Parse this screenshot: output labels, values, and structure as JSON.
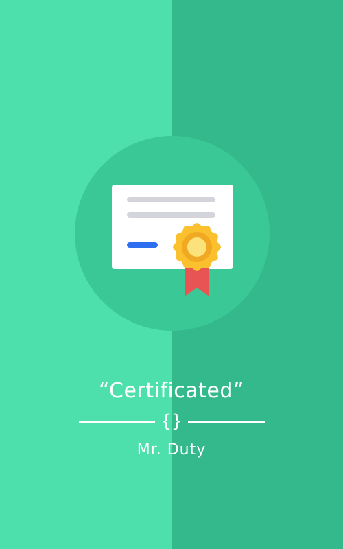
{
  "colors": {
    "background_left": "#4ddfac",
    "background_right": "#33b98b",
    "circle": "#39c896",
    "card": "#ffffff",
    "card_lines": "#d4d5db",
    "card_accent": "#2e6ff0",
    "medal_outer": "#fbc02d",
    "medal_ring": "#f1a923",
    "medal_inner": "#fbe27a",
    "ribbon": "#e85454",
    "text": "#ffffff"
  },
  "icons": {
    "illustration": "certificate-icon",
    "divider_glyph": "curly-braces"
  },
  "content": {
    "title": "“Certificated”",
    "divider_symbol": "{}",
    "author": "Mr. Duty"
  }
}
